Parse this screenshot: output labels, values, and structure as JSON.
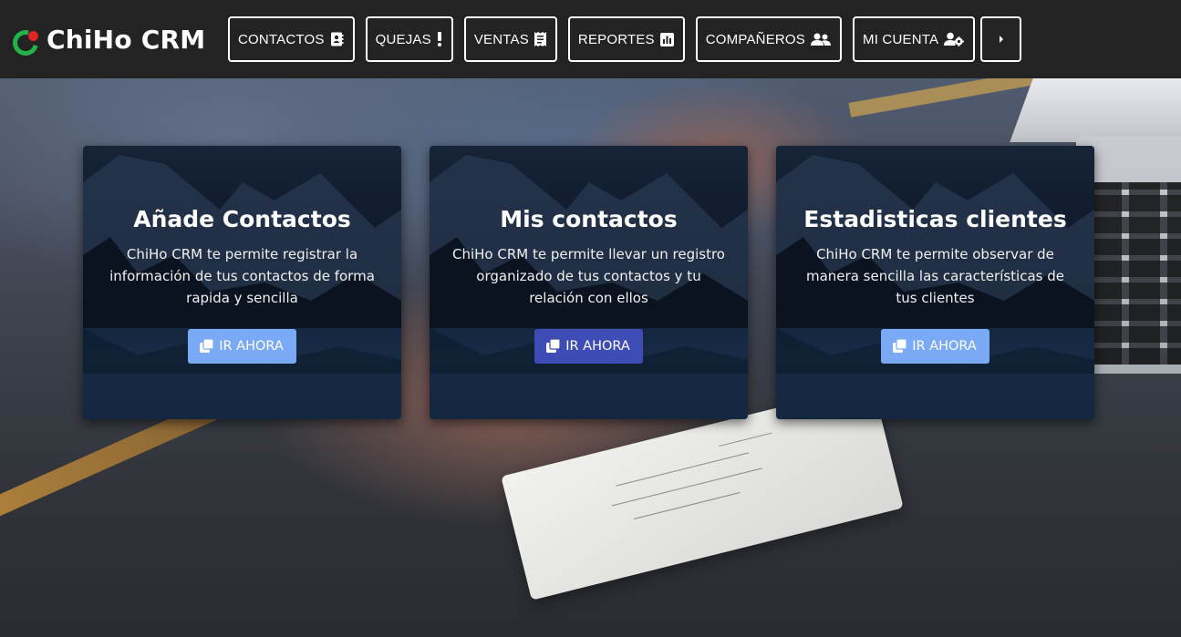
{
  "brand": {
    "name": "ChiHo CRM",
    "logo_icon": "chiho-logo-icon",
    "logo_colors": {
      "ring": "#22b34a",
      "dot": "#e02424"
    }
  },
  "nav": {
    "items": [
      {
        "label": "CONTACTOS",
        "icon": "address-book-icon"
      },
      {
        "label": "QUEJAS",
        "icon": "exclamation-icon"
      },
      {
        "label": "VENTAS",
        "icon": "receipt-icon"
      },
      {
        "label": "REPORTES",
        "icon": "chart-bar-icon"
      },
      {
        "label": "COMPAÑEROS",
        "icon": "users-icon"
      },
      {
        "label": "MI CUENTA",
        "icon": "users-cog-icon"
      }
    ],
    "more_icon": "caret-right-icon"
  },
  "cards": [
    {
      "title": "Añade Contactos",
      "text": "ChiHo CRM te permite registrar la información de tus contactos de forma rapida y sencilla",
      "button_label": "IR AHORA",
      "button_icon": "clone-icon",
      "button_color": "#7aaaf5"
    },
    {
      "title": "Mis contactos",
      "text": "ChiHo CRM te permite llevar un registro organizado de tus contactos y tu relación con ellos",
      "button_label": "IR AHORA",
      "button_icon": "clone-icon",
      "button_color": "#3d4db5"
    },
    {
      "title": "Estadisticas clientes",
      "text": "ChiHo CRM te permite observar de manera sencilla las características de tus clientes",
      "button_label": "IR AHORA",
      "button_icon": "clone-icon",
      "button_color": "#7aaaf5"
    }
  ],
  "colors": {
    "navbar_bg": "#232323",
    "text": "#ffffff"
  }
}
